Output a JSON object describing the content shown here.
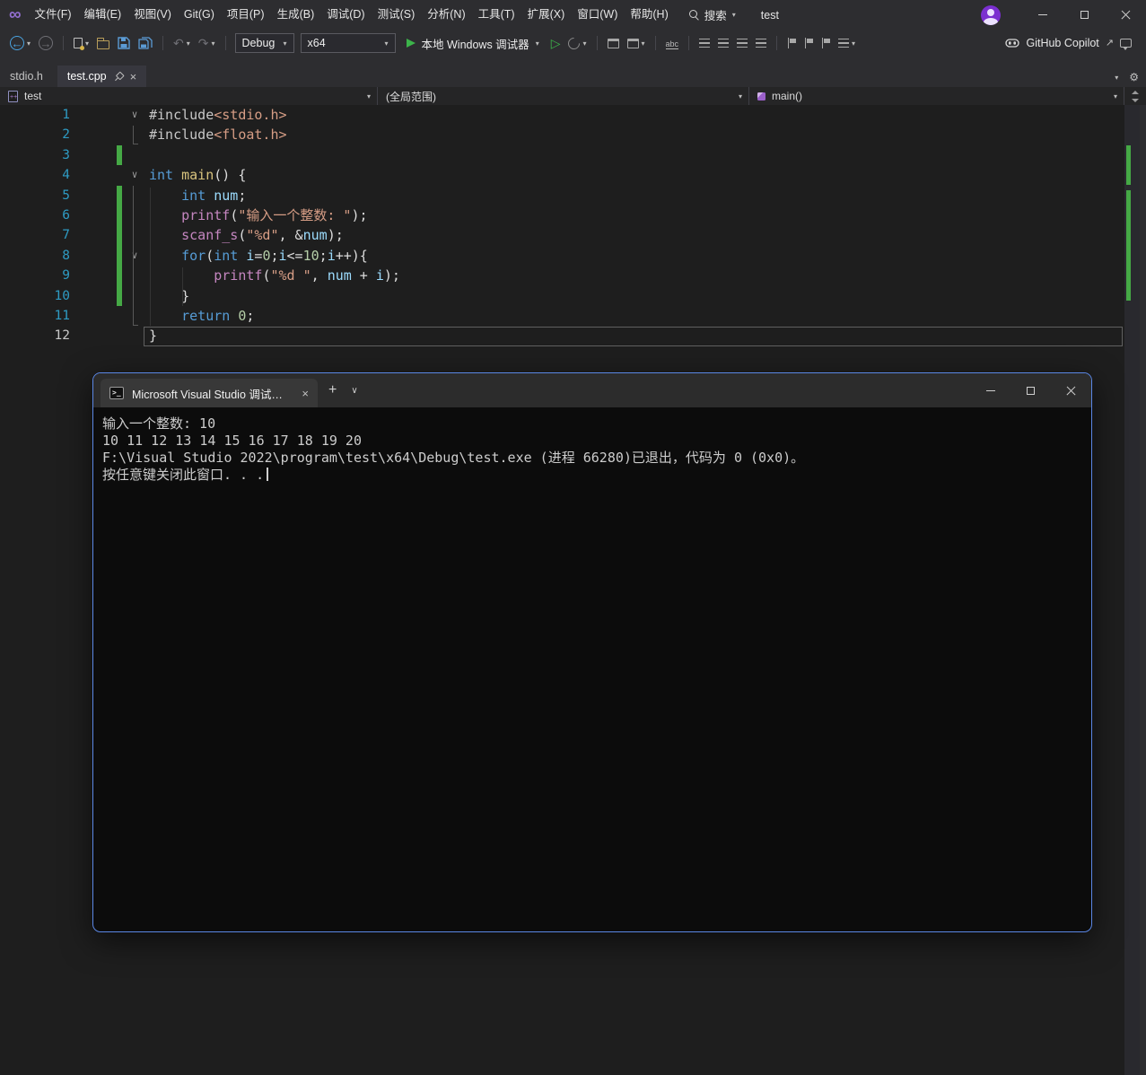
{
  "menubar": {
    "items": [
      "文件(F)",
      "编辑(E)",
      "视图(V)",
      "Git(G)",
      "项目(P)",
      "生成(B)",
      "调试(D)",
      "测试(S)",
      "分析(N)",
      "工具(T)",
      "扩展(X)",
      "窗口(W)",
      "帮助(H)"
    ],
    "search_label": "搜索",
    "solution_label": "test"
  },
  "toolbar": {
    "config_value": "Debug",
    "platform_value": "x64",
    "run_label": "本地 Windows 调试器",
    "copilot_label": "GitHub Copilot"
  },
  "tabs": [
    {
      "label": "stdio.h",
      "active": false
    },
    {
      "label": "test.cpp",
      "active": true
    }
  ],
  "navbar": {
    "project": "test",
    "scope": "(全局范围)",
    "member": "main()"
  },
  "editor": {
    "lines": [
      {
        "n": 1,
        "fold": true,
        "tokens": [
          [
            "pre",
            "#include"
          ],
          [
            "str",
            "<stdio.h>"
          ]
        ]
      },
      {
        "n": 2,
        "tokens": [
          [
            "pre",
            "#include"
          ],
          [
            "str",
            "<float.h>"
          ]
        ]
      },
      {
        "n": 3,
        "chg": true,
        "tokens": []
      },
      {
        "n": 4,
        "fold": true,
        "tokens": [
          [
            "kw",
            "int"
          ],
          [
            "pln",
            " "
          ],
          [
            "fn",
            "main"
          ],
          [
            "pln",
            "() {"
          ]
        ]
      },
      {
        "n": 5,
        "chg": true,
        "tokens": [
          [
            "pln",
            "    "
          ],
          [
            "kw",
            "int"
          ],
          [
            "pln",
            " "
          ],
          [
            "var",
            "num"
          ],
          [
            "pln",
            ";"
          ]
        ]
      },
      {
        "n": 6,
        "chg": true,
        "tokens": [
          [
            "pln",
            "    "
          ],
          [
            "fnp",
            "printf"
          ],
          [
            "pln",
            "("
          ],
          [
            "str",
            "\"输入一个整数: \""
          ],
          [
            "pln",
            ");"
          ]
        ]
      },
      {
        "n": 7,
        "chg": true,
        "tokens": [
          [
            "pln",
            "    "
          ],
          [
            "fnp",
            "scanf_s"
          ],
          [
            "pln",
            "("
          ],
          [
            "str",
            "\"%d\""
          ],
          [
            "pln",
            ", &"
          ],
          [
            "var",
            "num"
          ],
          [
            "pln",
            ");"
          ]
        ]
      },
      {
        "n": 8,
        "fold": true,
        "chg": true,
        "tokens": [
          [
            "pln",
            "    "
          ],
          [
            "kw",
            "for"
          ],
          [
            "pln",
            "("
          ],
          [
            "kw",
            "int"
          ],
          [
            "pln",
            " "
          ],
          [
            "var",
            "i"
          ],
          [
            "pln",
            "="
          ],
          [
            "num",
            "0"
          ],
          [
            "pln",
            ";"
          ],
          [
            "var",
            "i"
          ],
          [
            "pln",
            "<="
          ],
          [
            "num",
            "10"
          ],
          [
            "pln",
            ";"
          ],
          [
            "var",
            "i"
          ],
          [
            "pln",
            "++){"
          ]
        ]
      },
      {
        "n": 9,
        "chg": true,
        "tokens": [
          [
            "pln",
            "        "
          ],
          [
            "fnp",
            "printf"
          ],
          [
            "pln",
            "("
          ],
          [
            "str",
            "\"%d \""
          ],
          [
            "pln",
            ", "
          ],
          [
            "var",
            "num"
          ],
          [
            "pln",
            " + "
          ],
          [
            "var",
            "i"
          ],
          [
            "pln",
            ");"
          ]
        ]
      },
      {
        "n": 10,
        "chg": true,
        "tokens": [
          [
            "pln",
            "    }"
          ]
        ]
      },
      {
        "n": 11,
        "tokens": [
          [
            "pln",
            "    "
          ],
          [
            "kw",
            "return"
          ],
          [
            "pln",
            " "
          ],
          [
            "num",
            "0"
          ],
          [
            "pln",
            ";"
          ]
        ]
      },
      {
        "n": 12,
        "cur": true,
        "tokens": [
          [
            "pln",
            "}"
          ]
        ]
      }
    ]
  },
  "console": {
    "tab_title": "Microsoft Visual Studio 调试…",
    "lines": [
      "输入一个整数: 10",
      "10 11 12 13 14 15 16 17 18 19 20",
      "F:\\Visual Studio 2022\\program\\test\\x64\\Debug\\test.exe (进程 66280)已退出，代码为 0 (0x0)。",
      "按任意键关闭此窗口. . ."
    ]
  },
  "icons": {
    "logo": "∞",
    "caret": "▾",
    "chevron": "∨",
    "close": "×",
    "undo": "↶",
    "redo": "↷",
    "back": "←",
    "forward": "→",
    "play_outline": "▷",
    "plus": "+",
    "external": "↗",
    "gear": "⚙"
  },
  "colors": {
    "accent_green": "#3CB44A",
    "change_bar": "#45A945",
    "console_border": "#5B87E5",
    "editor_bg": "#1E1E1E",
    "chrome_bg": "#2D2D30"
  }
}
